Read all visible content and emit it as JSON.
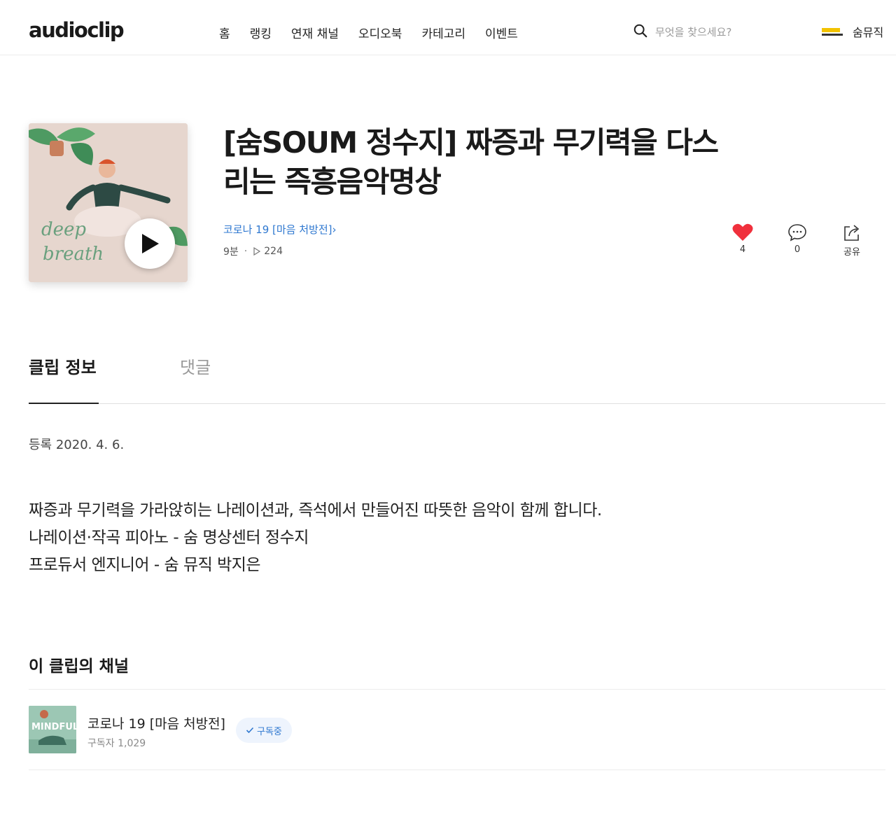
{
  "header": {
    "logo": "audioclip",
    "nav": [
      "홈",
      "랭킹",
      "연재 채널",
      "오디오북",
      "카테고리",
      "이벤트"
    ],
    "search_placeholder": "무엇을 찾으세요?",
    "profile_name": "숨뮤직"
  },
  "clip": {
    "title_line1": "[숨SOUM 정수지] 짜증과 무기력을 다스",
    "title_line2": "리는 즉흥음악명상",
    "channel_link": "코로나 19 [마음 처방전]",
    "duration": "9분",
    "plays": "224",
    "likes": "4",
    "comments": "0",
    "share_label": "공유"
  },
  "tabs": {
    "info": "클립 정보",
    "comments": "댓글"
  },
  "info": {
    "registered": "등록 2020. 4. 6.",
    "description": [
      "짜증과 무기력을 가라앉히는 나레이션과, 즉석에서 만들어진 따뜻한 음악이 함께 합니다.",
      "",
      "나레이션·작곡 피아노 - 숨 명상센터 정수지",
      "프로듀서 엔지니어 - 숨 뮤직 박지은"
    ]
  },
  "channel_section": {
    "title": "이 클립의 채널",
    "name": "코로나 19 [마음 처방전]",
    "subscribers": "구독자 1,029",
    "subscribe_label": "구독중",
    "thumb_text": "MINDFUL"
  },
  "cover": {
    "text1": "deep",
    "text2": "breath"
  },
  "colors": {
    "accent": "#2f78d0",
    "heart": "#f0303c"
  }
}
